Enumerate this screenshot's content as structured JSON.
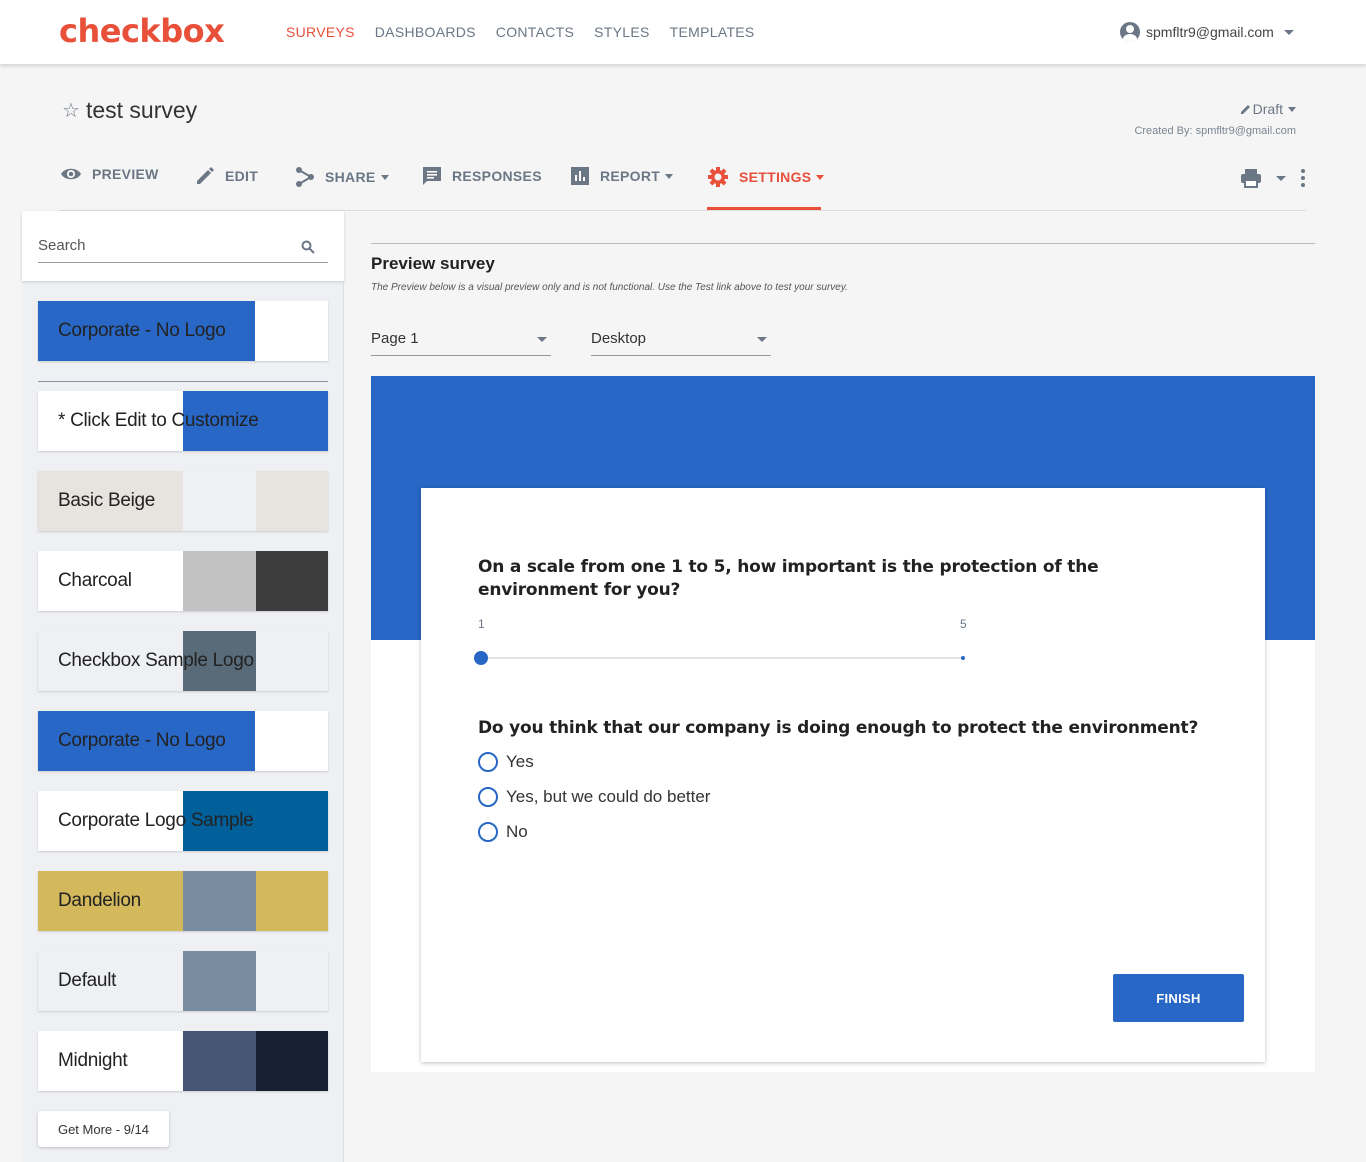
{
  "brand": {
    "logo": "checkbox",
    "accent": "#e8503a",
    "survey_blue": "#2867c5"
  },
  "topnav": {
    "items": [
      "SURVEYS",
      "DASHBOARDS",
      "CONTACTS",
      "STYLES",
      "TEMPLATES"
    ],
    "active": "SURVEYS"
  },
  "user": {
    "email": "spmfltr9@gmail.com",
    "icon": "account-circle-icon"
  },
  "survey": {
    "title": "test survey",
    "status": "Draft",
    "created_by": "Created By: spmfltr9@gmail.com"
  },
  "tabs": {
    "preview": "PREVIEW",
    "edit": "EDIT",
    "share": "SHARE",
    "responses": "RESPONSES",
    "report": "REPORT",
    "settings": "SETTINGS",
    "active": "SETTINGS"
  },
  "sidebar": {
    "search_placeholder": "Search",
    "styles": [
      {
        "name": "Corporate - No Logo",
        "colors": [
          "#2867c5",
          "#2867c5",
          "#2867c5",
          "#ffffff"
        ]
      },
      {
        "name": "* Click Edit to Customize",
        "colors": [
          "#ffffff",
          "#ffffff",
          "#2867c5",
          "#2867c5"
        ]
      },
      {
        "name": "Basic Beige",
        "colors": [
          "#e7e3de",
          "#e7e3de",
          "#eef0f3",
          "#e7e3de"
        ]
      },
      {
        "name": "Charcoal",
        "colors": [
          "#ffffff",
          "#ffffff",
          "#c2c2c2",
          "#3d3d3d"
        ]
      },
      {
        "name": "Checkbox Sample Logo",
        "colors": [
          "#eef0f3",
          "#eef0f3",
          "#596b78",
          "#eef0f3"
        ]
      },
      {
        "name": "Corporate - No Logo",
        "colors": [
          "#2867c5",
          "#2867c5",
          "#2867c5",
          "#ffffff"
        ]
      },
      {
        "name": "Corporate Logo Sample",
        "colors": [
          "#ffffff",
          "#ffffff",
          "#015f9a",
          "#015f9a"
        ]
      },
      {
        "name": "Dandelion",
        "colors": [
          "#d3b85c",
          "#d3b85c",
          "#798da1",
          "#d3b85c"
        ]
      },
      {
        "name": "Default",
        "colors": [
          "#eef0f3",
          "#eef0f3",
          "#798da1",
          "#eef0f3"
        ]
      },
      {
        "name": "Midnight",
        "colors": [
          "#ffffff",
          "#ffffff",
          "#475574",
          "#162233"
        ]
      }
    ],
    "get_more": "Get More - 9/14"
  },
  "preview": {
    "title": "Preview survey",
    "subtitle": "The Preview below is a visual preview only and is not functional. Use the Test link above to test your survey.",
    "page_select": "Page 1",
    "device_select": "Desktop",
    "q1": "On a scale from one 1 to 5, how important is the protection of the environment for you?",
    "slider_min": "1",
    "slider_max": "5",
    "q2": "Do you think that our company is doing enough to protect the environment?",
    "options": [
      "Yes",
      "Yes, but we could do better",
      "No"
    ],
    "finish": "FINISH"
  }
}
